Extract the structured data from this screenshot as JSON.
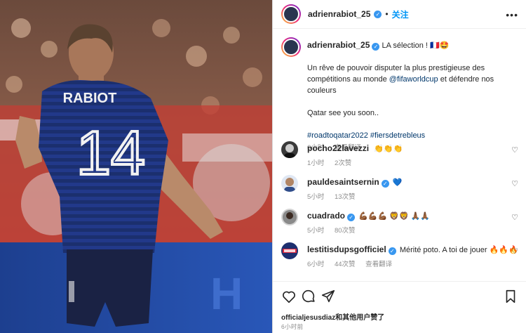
{
  "post": {
    "username": "adrienrabiot_25",
    "follow_label": "关注",
    "more_label": "•••"
  },
  "caption": {
    "username": "adrienrabiot_25",
    "line1": "LA sélection ! 🇫🇷🤩",
    "line2a": "Un rêve de pouvoir disputer la plus prestigieuse des compétitions au monde ",
    "mention": "@fifaworldcup",
    "line2b": " et défendre nos couleurs",
    "line3": "Qatar see you soon..",
    "hashtags": "#roadtoqatar2022 #fiersdetrebleus",
    "time": "6小时",
    "translate": "查看翻译"
  },
  "comments": [
    {
      "username": "pocho22lavezzi",
      "verified": false,
      "text": "👏👏👏",
      "time": "1小时",
      "likes": "2次赞",
      "translate": ""
    },
    {
      "username": "pauldesaintsernin",
      "verified": true,
      "text": "💙",
      "time": "5小时",
      "likes": "13次赞",
      "translate": ""
    },
    {
      "username": "cuadrado",
      "verified": true,
      "text": "💪🏾💪🏾💪🏾 🦁🦁 🙏🏾🙏🏾",
      "time": "5小时",
      "likes": "80次赞",
      "translate": ""
    },
    {
      "username": "lestitisdupsgofficiel",
      "verified": true,
      "text": "Mérité poto. A toi de jouer 🔥🔥🔥",
      "time": "6小时",
      "likes": "44次赞",
      "translate": "查看翻译"
    }
  ],
  "footer": {
    "liked_by": "officialjesusdiaz和其他用户赞了",
    "posted": "6小时前"
  },
  "media": {
    "player_name": "RABIOT",
    "player_number": "14"
  },
  "colors": {
    "accent": "#0095f6",
    "verified": "#3897f0",
    "hashtag": "#00376b",
    "jersey": "#1b2f6e"
  }
}
